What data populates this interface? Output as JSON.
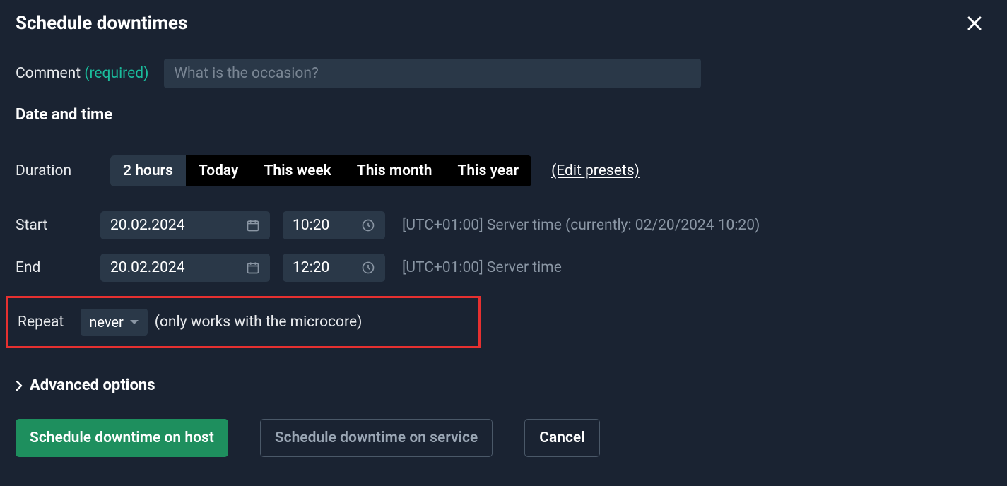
{
  "header": {
    "title": "Schedule downtimes"
  },
  "comment": {
    "label": "Comment",
    "required_text": "(required)",
    "placeholder": "What is the occasion?"
  },
  "datetime_section_title": "Date and time",
  "duration": {
    "label": "Duration",
    "presets": [
      "2 hours",
      "Today",
      "This week",
      "This month",
      "This year"
    ],
    "active_preset_index": 0,
    "edit_link": "(Edit presets)"
  },
  "start": {
    "label": "Start",
    "date": "20.02.2024",
    "time": "10:20",
    "tz_note": "[UTC+01:00] Server time (currently: 02/20/2024 10:20)"
  },
  "end": {
    "label": "End",
    "date": "20.02.2024",
    "time": "12:20",
    "tz_note": "[UTC+01:00] Server time"
  },
  "repeat": {
    "label": "Repeat",
    "value": "never",
    "note": "(only works with the microcore)"
  },
  "advanced": {
    "title": "Advanced options"
  },
  "actions": {
    "primary": "Schedule downtime on host",
    "secondary": "Schedule downtime on service",
    "cancel": "Cancel"
  }
}
